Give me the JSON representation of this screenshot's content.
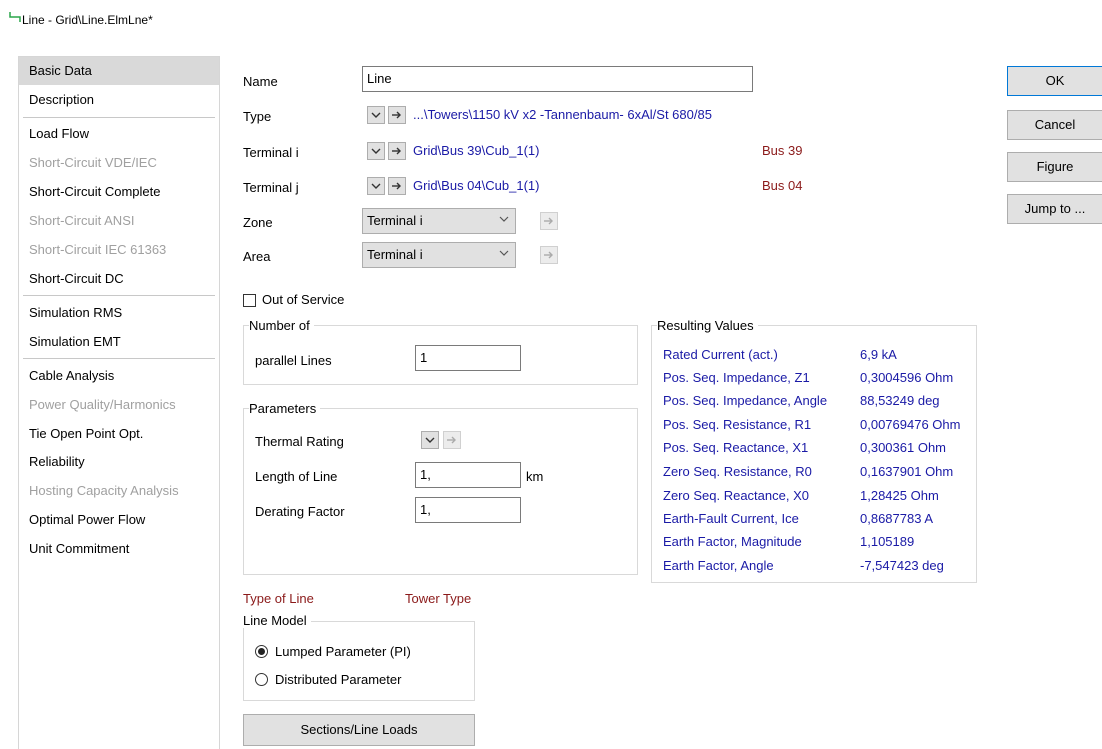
{
  "window": {
    "title": "Line - Grid\\Line.ElmLne*"
  },
  "sidebar": {
    "items": [
      {
        "label": "Basic Data",
        "state": "active"
      },
      {
        "label": "Description",
        "state": "normal"
      },
      {
        "label": "Load Flow",
        "state": "normal"
      },
      {
        "label": "Short-Circuit VDE/IEC",
        "state": "disabled"
      },
      {
        "label": "Short-Circuit Complete",
        "state": "normal"
      },
      {
        "label": "Short-Circuit ANSI",
        "state": "disabled"
      },
      {
        "label": "Short-Circuit IEC 61363",
        "state": "disabled"
      },
      {
        "label": "Short-Circuit DC",
        "state": "normal"
      },
      {
        "label": "Simulation RMS",
        "state": "normal"
      },
      {
        "label": "Simulation EMT",
        "state": "normal"
      },
      {
        "label": "Cable Analysis",
        "state": "normal"
      },
      {
        "label": "Power Quality/Harmonics",
        "state": "disabled"
      },
      {
        "label": "Tie Open Point Opt.",
        "state": "normal"
      },
      {
        "label": "Reliability",
        "state": "normal"
      },
      {
        "label": "Hosting Capacity Analysis",
        "state": "disabled"
      },
      {
        "label": "Optimal Power Flow",
        "state": "normal"
      },
      {
        "label": "Unit Commitment",
        "state": "normal"
      }
    ]
  },
  "form": {
    "name_label": "Name",
    "name_value": "Line",
    "type_label": "Type",
    "type_value": "...\\Towers\\1150 kV x2 -Tannenbaum- 6xAl/St 680/85",
    "terminal_i_label": "Terminal i",
    "terminal_i_value": "Grid\\Bus 39\\Cub_1(1)",
    "terminal_i_bus": "Bus 39",
    "terminal_j_label": "Terminal j",
    "terminal_j_value": "Grid\\Bus 04\\Cub_1(1)",
    "terminal_j_bus": "Bus 04",
    "zone_label": "Zone",
    "zone_value": "Terminal i",
    "area_label": "Area",
    "area_value": "Terminal i",
    "out_of_service_label": "Out of Service",
    "out_of_service_checked": false
  },
  "number_of": {
    "title": "Number of",
    "parallel_label": "parallel Lines",
    "parallel_value": "1"
  },
  "parameters": {
    "title": "Parameters",
    "thermal_label": "Thermal Rating",
    "length_label": "Length of Line",
    "length_value": "1,",
    "length_unit": "km",
    "derating_label": "Derating Factor",
    "derating_value": "1,"
  },
  "results": {
    "title": "Resulting Values",
    "rows": [
      {
        "label": "Rated Current (act.)",
        "value": "6,9 kA"
      },
      {
        "label": "Pos. Seq. Impedance, Z1",
        "value": "0,3004596 Ohm"
      },
      {
        "label": "Pos. Seq. Impedance, Angle",
        "value": "88,53249 deg"
      },
      {
        "label": "Pos. Seq. Resistance, R1",
        "value": "0,00769476 Ohm"
      },
      {
        "label": "Pos. Seq. Reactance, X1",
        "value": "0,300361 Ohm"
      },
      {
        "label": "Zero Seq. Resistance, R0",
        "value": "0,1637901 Ohm"
      },
      {
        "label": "Zero Seq. Reactance, X0",
        "value": "1,28425 Ohm"
      },
      {
        "label": "Earth-Fault Current, Ice",
        "value": "0,8687783 A"
      },
      {
        "label": "Earth Factor, Magnitude",
        "value": "1,105189"
      },
      {
        "label": "Earth Factor, Angle",
        "value": "-7,547423 deg"
      }
    ]
  },
  "line_model": {
    "type_of_line": "Type of Line",
    "tower_type": "Tower Type",
    "title": "Line Model",
    "option_lumped": "Lumped Parameter (PI)",
    "option_distributed": "Distributed Parameter",
    "selected": "lumped"
  },
  "sections_button": "Sections/Line Loads",
  "buttons": {
    "ok": "OK",
    "cancel": "Cancel",
    "figure": "Figure",
    "jump": "Jump to ..."
  },
  "colors": {
    "link_blue": "#1a1aa6",
    "dark_red": "#8b1a1a",
    "active_bg": "#d9d9d9",
    "disabled_text": "#a0a0a0"
  }
}
